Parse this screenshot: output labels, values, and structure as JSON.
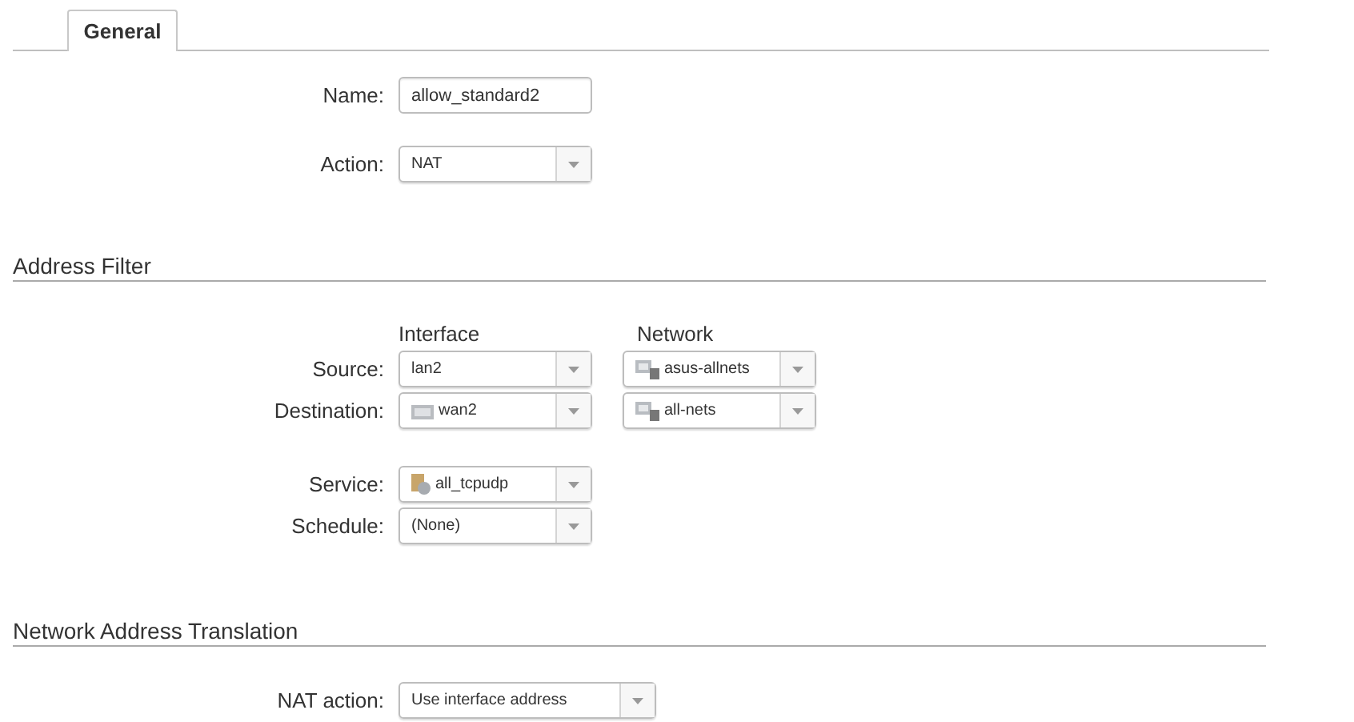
{
  "tabs": [
    {
      "label": "General",
      "selected": true
    }
  ],
  "general": [
    {
      "label": "Name:",
      "kind": "text",
      "value": "allow_standard2"
    },
    {
      "label": "Action:",
      "kind": "select",
      "value": "NAT"
    }
  ],
  "address_filter": {
    "title": "Address Filter",
    "columns": [
      "Interface",
      "Network"
    ],
    "rows": [
      {
        "label": "Source:",
        "interface": {
          "value": "lan2",
          "kind": "plain"
        },
        "network": {
          "value": "asus-allnets",
          "kind": "network"
        }
      },
      {
        "label": "Destination:",
        "interface": {
          "value": "wan2",
          "kind": "interface"
        },
        "network": {
          "value": "all-nets",
          "kind": "network"
        }
      }
    ],
    "extra": [
      {
        "label": "Service:",
        "value": "all_tcpudp",
        "kind": "service"
      },
      {
        "label": "Schedule:",
        "value": "(None)",
        "kind": "plain"
      }
    ]
  },
  "nat": {
    "title": "Network Address Translation",
    "fields": [
      {
        "label": "NAT action:",
        "value": "Use interface address"
      }
    ]
  }
}
